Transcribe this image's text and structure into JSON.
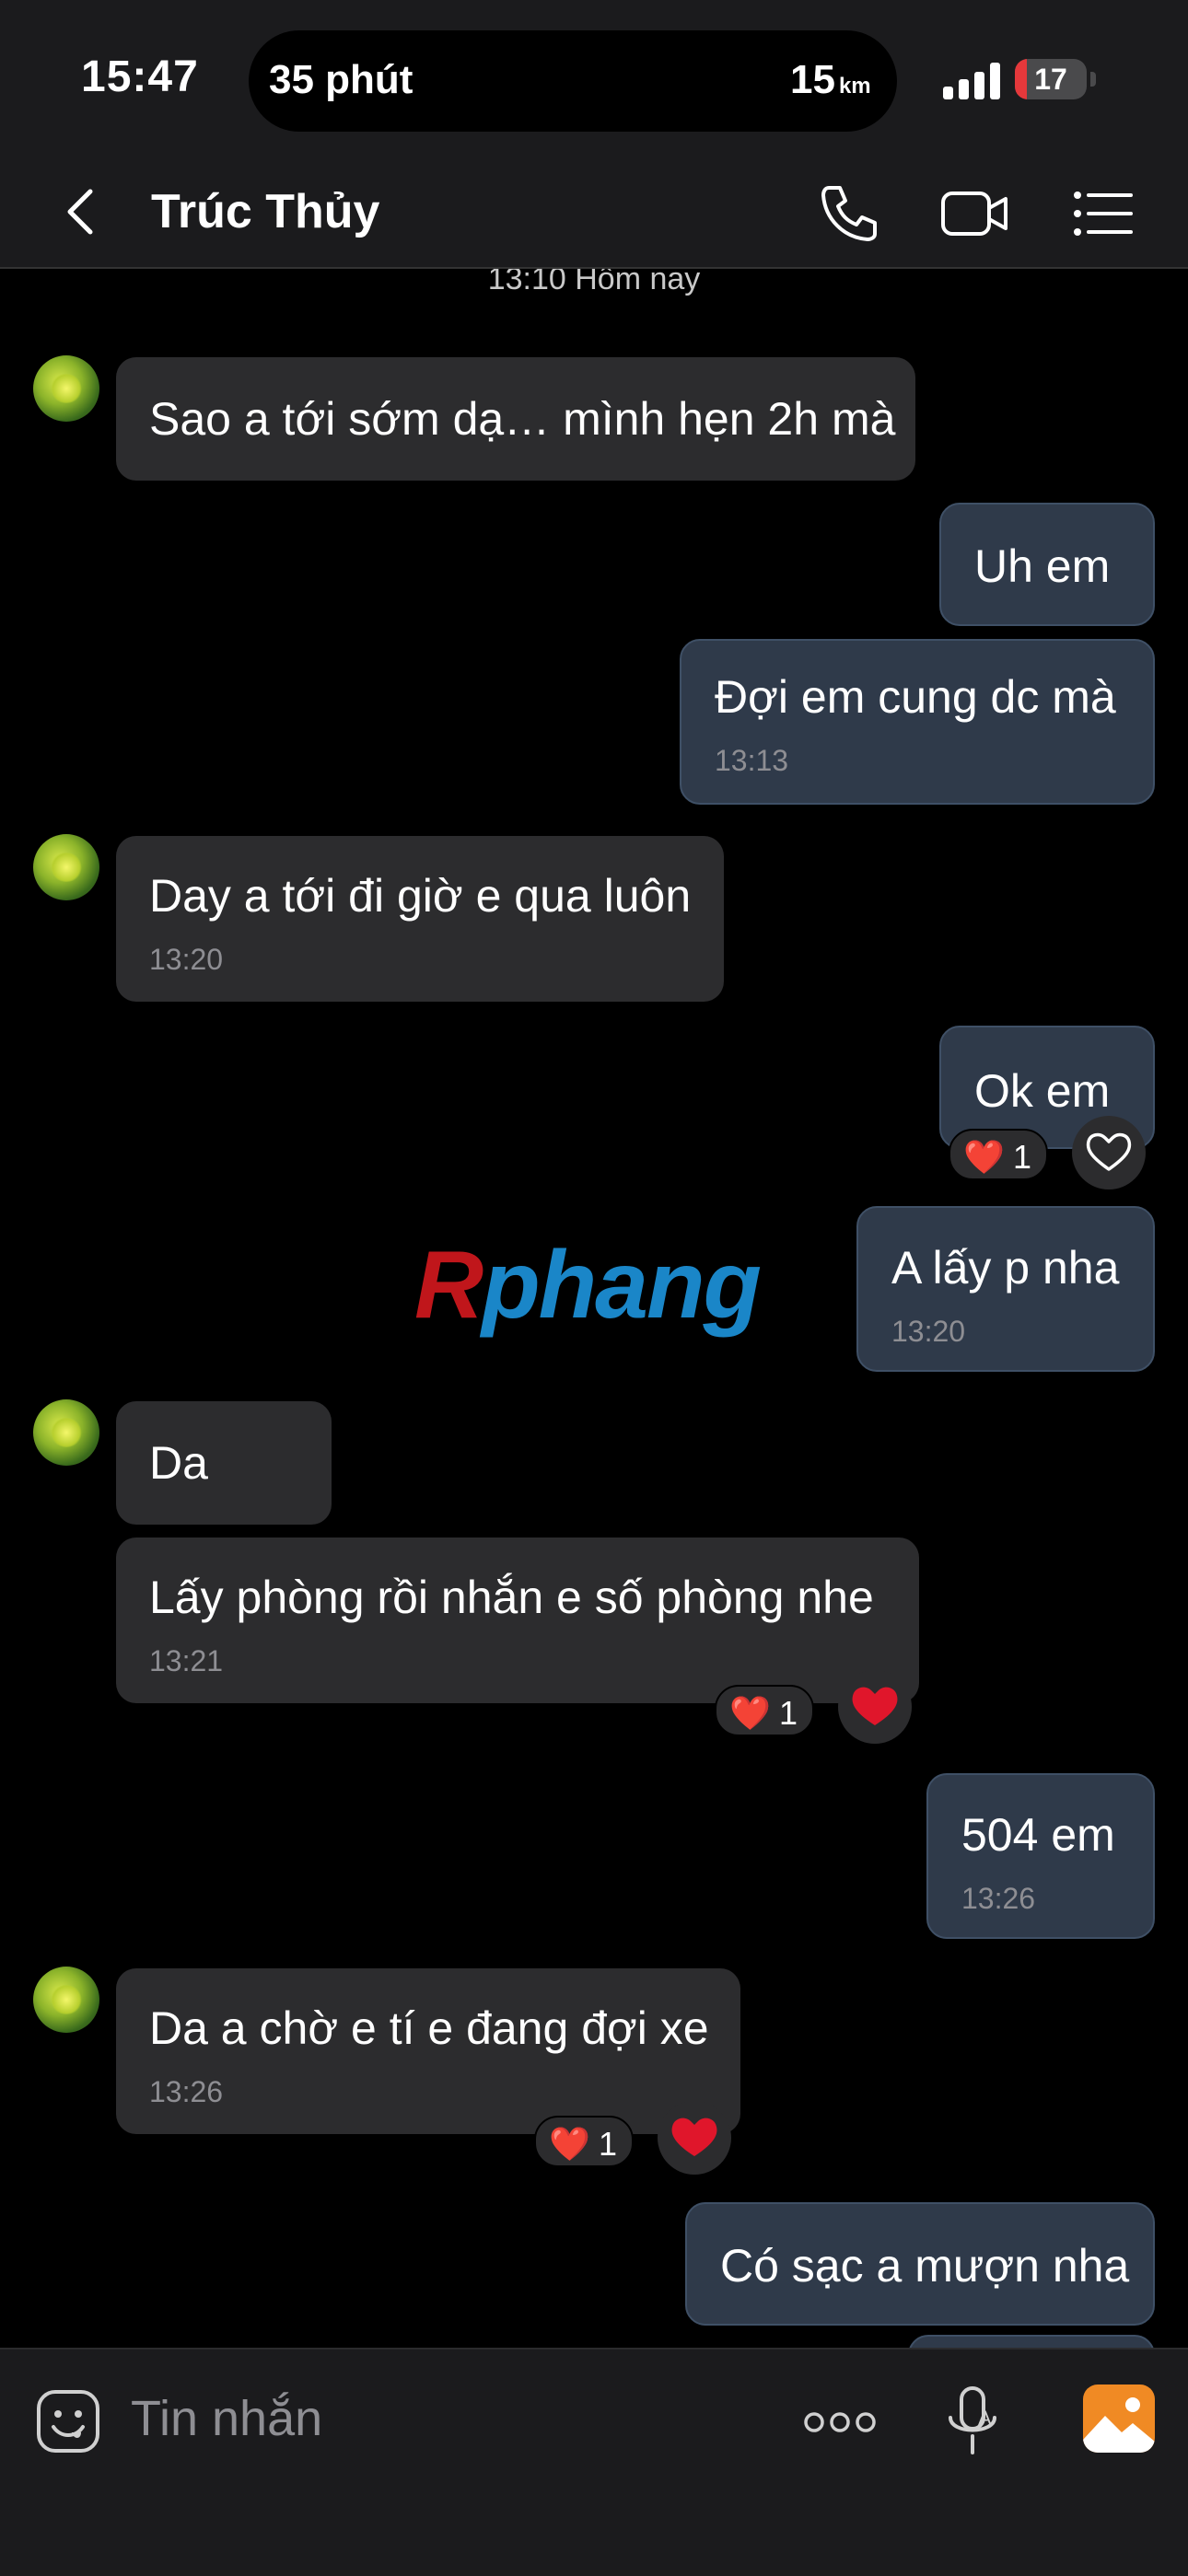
{
  "status_bar": {
    "time": "15:47",
    "nav_eta": "35 phút",
    "nav_distance": "15",
    "nav_unit": "km",
    "battery": "17",
    "battery_level": 0.17,
    "battery_color": "#e5383b"
  },
  "header": {
    "contact_name": "Trúc Thủy",
    "icons": [
      "back-icon",
      "phone-icon",
      "video-call-icon",
      "menu-list-icon"
    ]
  },
  "chat": {
    "day_label": "13:10 Hôm nay",
    "messages": [
      {
        "side": "in",
        "text": "Sao a tới sớm dạ… mình hẹn 2h mà",
        "time": ""
      },
      {
        "side": "out",
        "text": "Uh em",
        "time": ""
      },
      {
        "side": "out",
        "text": "Đợi em cung dc mà",
        "time": "13:13"
      },
      {
        "side": "in",
        "text": "Day a tới đi giờ e qua luôn",
        "time": "13:20"
      },
      {
        "side": "out",
        "text": "Ok em",
        "time": "",
        "reaction_count": "1"
      },
      {
        "side": "out",
        "text": "A lấy p nha",
        "time": "13:20"
      },
      {
        "side": "in",
        "text": "Da",
        "time": ""
      },
      {
        "side": "in",
        "text": "Lấy phòng rồi nhắn e số phòng nhe",
        "time": "13:21",
        "reaction_count": "1"
      },
      {
        "side": "out",
        "text": "504 em",
        "time": "13:26"
      },
      {
        "side": "in",
        "text": "Da a chờ e tí e đang đợi xe",
        "time": "13:26",
        "reaction_count": "1"
      },
      {
        "side": "out",
        "text": "Có sạc a mượn nha",
        "time": ""
      }
    ],
    "colors": {
      "incoming": "#2c2c2e",
      "outgoing": "#2f3a4a",
      "heart": "#e0162b"
    }
  },
  "watermark": {
    "first": "R",
    "rest": "phang"
  },
  "input_bar": {
    "placeholder": "Tin nhắn",
    "icons": [
      "emoji-icon",
      "more-options-icon",
      "voice-to-text-icon",
      "photo-gallery-icon"
    ]
  }
}
